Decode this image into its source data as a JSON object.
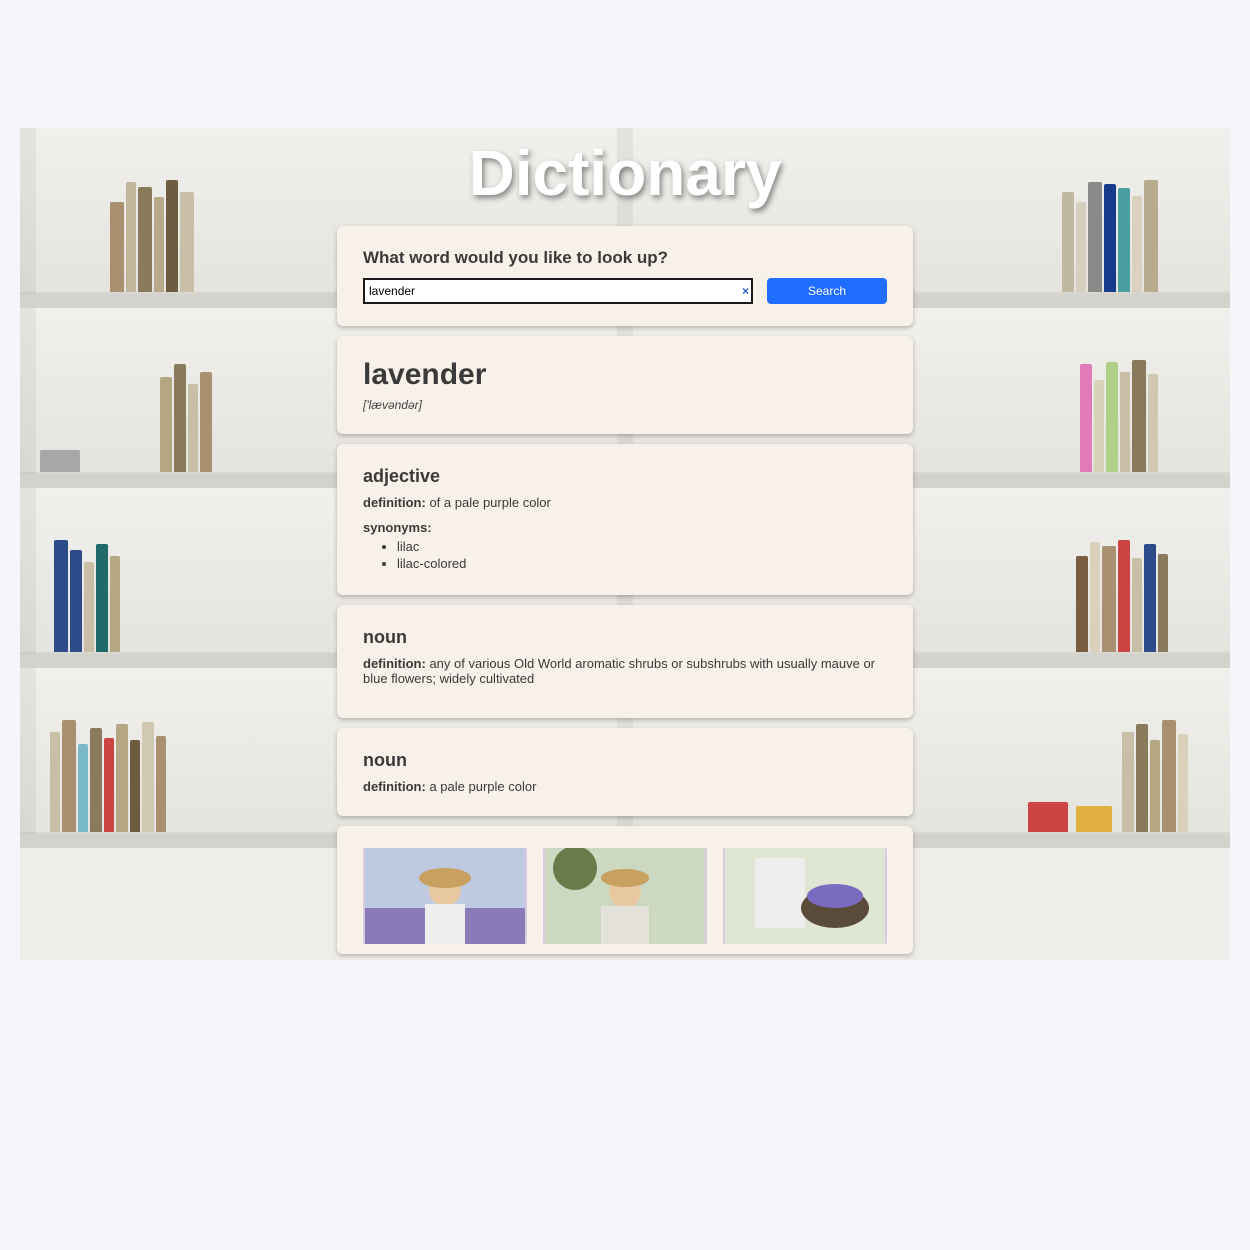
{
  "app_title": "Dictionary",
  "search": {
    "prompt": "What word would you like to look up?",
    "value": "lavender",
    "button_label": "Search",
    "clear_icon": "×"
  },
  "result": {
    "word": "lavender",
    "phonetic": "['lævəndər]"
  },
  "labels": {
    "definition_prefix": "definition:",
    "synonyms_heading": "synonyms:"
  },
  "entries": [
    {
      "part_of_speech": "adjective",
      "definition": "of a pale purple color",
      "synonyms": [
        "lilac",
        "lilac-colored"
      ]
    },
    {
      "part_of_speech": "noun",
      "definition": "any of various Old World aromatic shrubs or subshrubs with usually mauve or blue flowers; widely cultivated"
    },
    {
      "part_of_speech": "noun",
      "definition": "a pale purple color"
    }
  ],
  "images": [
    {
      "alt": "woman with hat in lavender field"
    },
    {
      "alt": "woman with hat outdoors"
    },
    {
      "alt": "person holding basket of lavender"
    }
  ]
}
